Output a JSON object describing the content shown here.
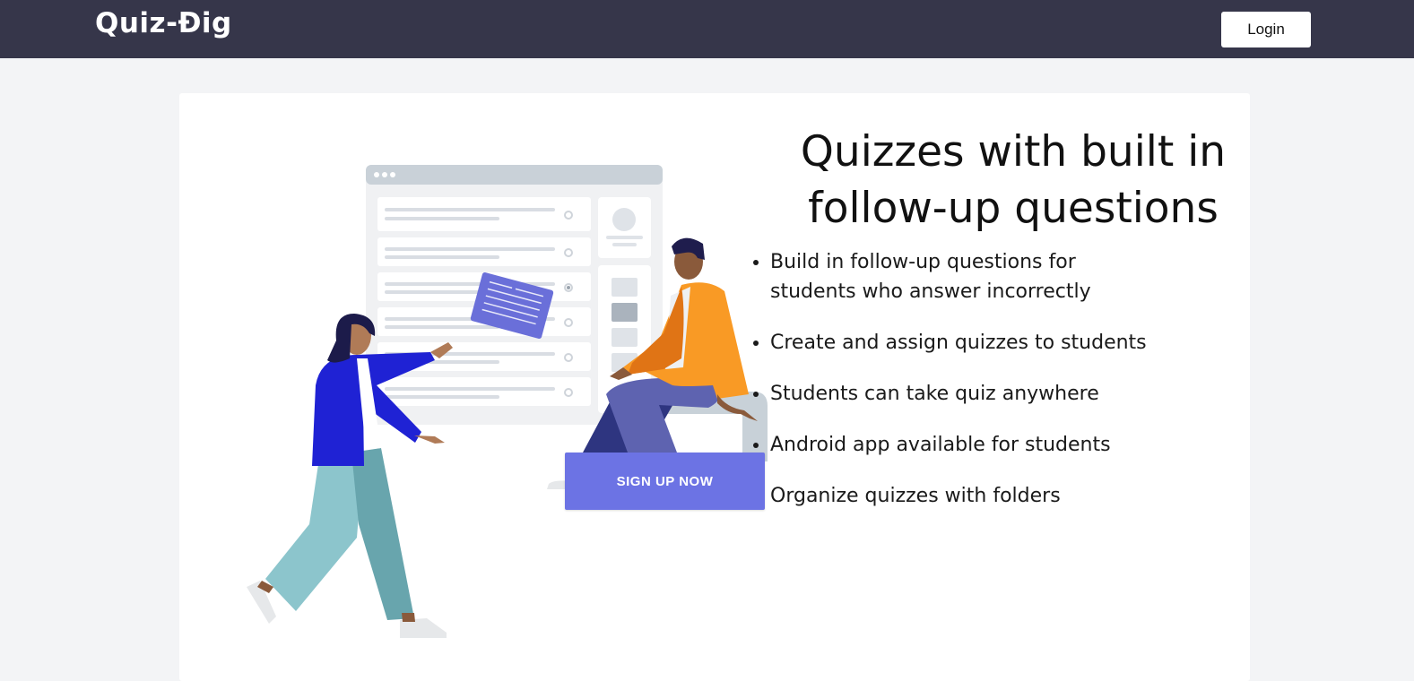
{
  "navbar": {
    "logo_text": "Quiz-Đig",
    "login_label": "Login"
  },
  "hero": {
    "headline": "Quizzes with built in follow-up questions",
    "features": [
      "Build in follow-up questions for students who answer incorrectly",
      "Create and assign quizzes to students",
      "Students can take quiz anywhere",
      "Android app available for students",
      "Organize quizzes with folders"
    ],
    "signup_label": "SIGN UP NOW"
  },
  "colors": {
    "navbar_bg": "#36364a",
    "page_bg": "#f3f4f6",
    "accent": "#6c73e4",
    "card_bg": "#ffffff"
  },
  "icons": {
    "illustration": "people-collaborating-on-quiz-illustration"
  }
}
